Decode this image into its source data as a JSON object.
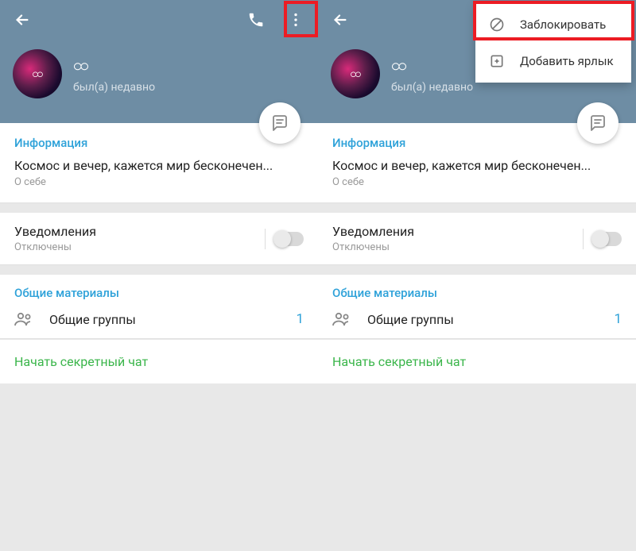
{
  "profile": {
    "username": "ထ",
    "status": "был(а) недавно",
    "avatar_symbol": "ထ"
  },
  "info": {
    "title": "Информация",
    "bio": "Космос и вечер, кажется мир бесконечен...",
    "bio_label": "О себе"
  },
  "notifications": {
    "title": "Уведомления",
    "status": "Отключены"
  },
  "shared": {
    "title": "Общие материалы",
    "groups_label": "Общие группы",
    "groups_count": "1"
  },
  "secret": {
    "label": "Начать секретный чат"
  },
  "menu": {
    "block": "Заблокировать",
    "shortcut": "Добавить ярлык"
  }
}
